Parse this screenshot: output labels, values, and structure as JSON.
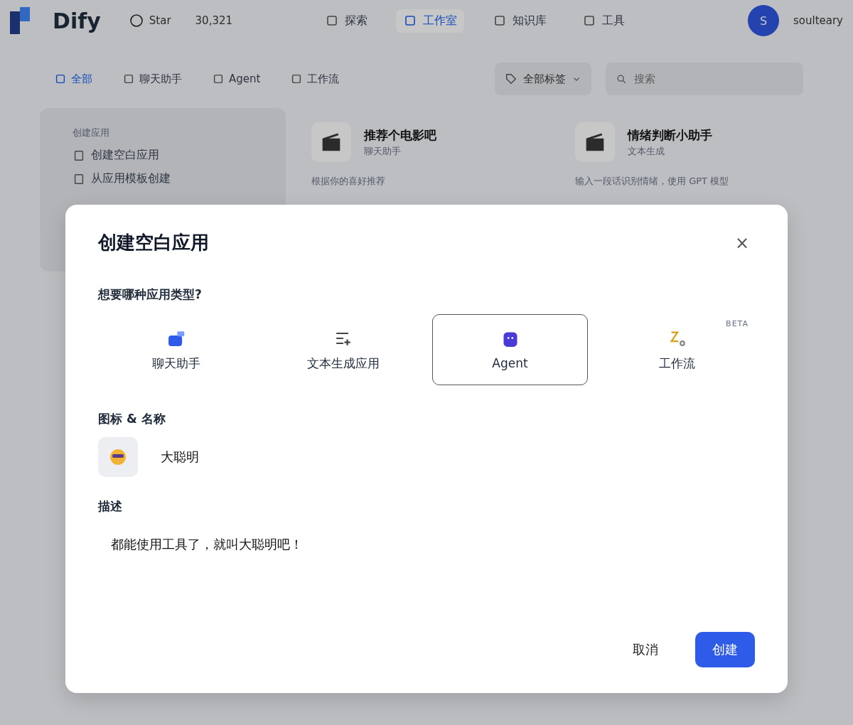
{
  "header": {
    "logo": "Dify",
    "star_label": "Star",
    "star_count": "30,321",
    "nav": [
      {
        "label": "探索",
        "selected": false
      },
      {
        "label": "工作室",
        "selected": true
      },
      {
        "label": "知识库",
        "selected": false
      },
      {
        "label": "工具",
        "selected": false
      }
    ],
    "user": {
      "initial": "S",
      "name": "soulteary"
    }
  },
  "filters": {
    "tabs": [
      {
        "label": "全部",
        "selected": true
      },
      {
        "label": "聊天助手",
        "selected": false
      },
      {
        "label": "Agent",
        "selected": false
      },
      {
        "label": "工作流",
        "selected": false
      }
    ],
    "tag_select": "全部标签",
    "search": {
      "placeholder": "搜索"
    }
  },
  "create_card": {
    "title": "创建应用",
    "items": [
      "创建空白应用",
      "从应用模板创建"
    ]
  },
  "apps": [
    {
      "name": "推荐个电影吧",
      "mode": "聊天助手",
      "description": "根据你的喜好推荐"
    },
    {
      "name": "情绪判断小助手",
      "mode": "文本生成",
      "description": "输入一段话识别情绪，使用 GPT 模型"
    }
  ],
  "modal": {
    "title": "创建空白应用",
    "close": "×",
    "type_label": "想要哪种应用类型?",
    "types": [
      {
        "label": "聊天助手",
        "selected": false
      },
      {
        "label": "文本生成应用",
        "selected": false
      },
      {
        "label": "Agent",
        "selected": true
      },
      {
        "label": "工作流",
        "selected": false,
        "badge": "BETA"
      }
    ],
    "name_label": "图标 & 名称",
    "name_value": "大聪明",
    "description_label": "描述",
    "description_value": "都能使用工具了，就叫大聪明吧！",
    "buttons": [
      {
        "label": "取消",
        "kind": "secondary"
      },
      {
        "label": "创建",
        "kind": "primary"
      }
    ]
  }
}
